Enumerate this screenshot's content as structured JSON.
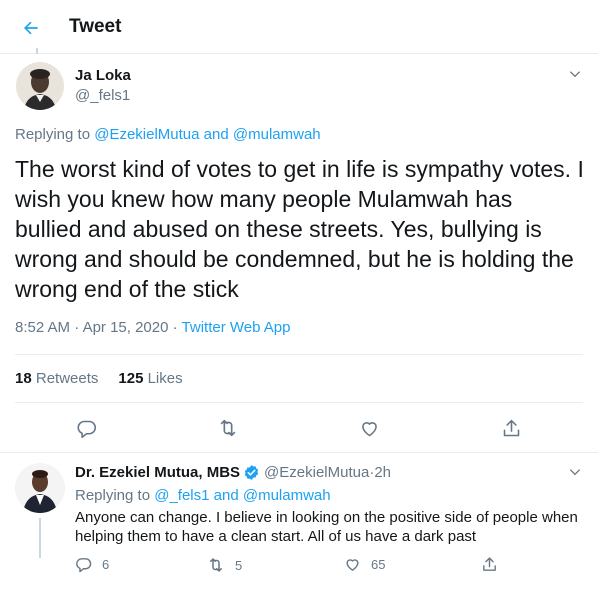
{
  "header": {
    "title": "Tweet",
    "back_icon": "arrow-left-icon"
  },
  "tweet": {
    "author_name": "Ja Loka",
    "author_handle": "@_fels1",
    "replying_prefix": "Replying to ",
    "replying_user1": "@EzekielMutua",
    "replying_and": " and ",
    "replying_user2": "@mulamwah",
    "text": "The worst kind of votes to get in life is sympathy votes. I wish you knew how many people Mulamwah has bullied and abused on these streets. Yes, bullying is wrong and should be condemned, but he is holding the wrong end of the stick",
    "time": "8:52 AM",
    "dot1": " · ",
    "date": "Apr 15, 2020",
    "dot2": " · ",
    "source": "Twitter Web App",
    "retweets_count": "18",
    "retweets_label": "Retweets",
    "likes_count": "125",
    "likes_label": "Likes"
  },
  "reply": {
    "author_name": "Dr. Ezekiel Mutua, MBS",
    "author_handle": "@EzekielMutua",
    "time_sep": " · ",
    "time": "2h",
    "replying_prefix": "Replying to ",
    "replying_user1": "@_fels1",
    "replying_and": " and ",
    "replying_user2": "@mulamwah",
    "text": "Anyone can change. I believe in looking on the positive side of people when helping them to have a clean start. All of us have a dark past",
    "reply_count": "6",
    "retweet_count": "5",
    "like_count": "65"
  },
  "colors": {
    "accent": "#1da1f2",
    "muted": "#657786",
    "border": "#e6ecf0"
  }
}
